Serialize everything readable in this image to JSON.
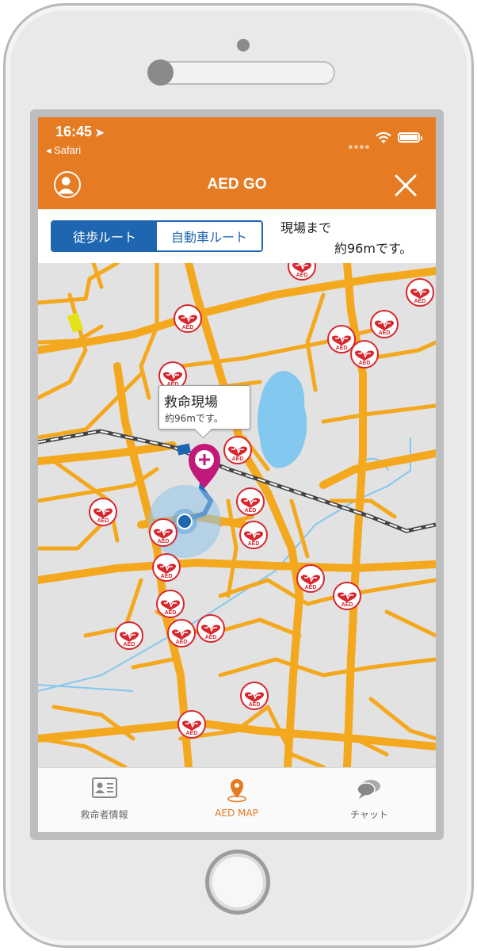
{
  "status_bar": {
    "time": "16:45",
    "back_app": "◂ Safari"
  },
  "header": {
    "title": "AED GO"
  },
  "route": {
    "walk_label": "徒歩ルート",
    "car_label": "自動車ルート",
    "distance_line1": "現場まで",
    "distance_line2": "約96mです。"
  },
  "map": {
    "callout_title": "救命現場",
    "callout_sub": "約96mです。",
    "aed_marker_label": "AED",
    "colors": {
      "road": "#f4a81d",
      "rail": "#444444",
      "water": "#83c8ee",
      "aed_red": "#d8262e",
      "pin": "#c2187a"
    }
  },
  "tabs": [
    {
      "label": "救命者情報",
      "icon": "id-card-icon"
    },
    {
      "label": "AED MAP",
      "icon": "map-pin-icon"
    },
    {
      "label": "チャット",
      "icon": "chat-bubbles-icon"
    }
  ],
  "accent": "#e57b22",
  "selected_tab": "AED MAP"
}
